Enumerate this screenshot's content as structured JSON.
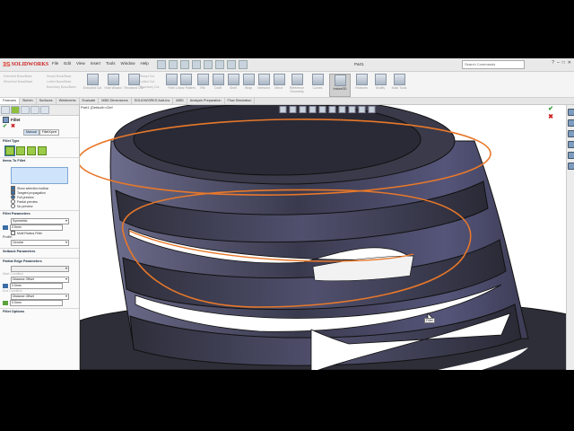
{
  "app": {
    "brand": "SOLIDWORKS",
    "menus": [
      "File",
      "Edit",
      "View",
      "Insert",
      "Tools",
      "Window",
      "Help"
    ],
    "doc_title": "Part1",
    "search_placeholder": "Search Commands"
  },
  "command_manager": {
    "small_col1": [
      "Extruded Boss/Base",
      "Revolved Boss/Base"
    ],
    "small_col2": [
      "Swept Boss/Base",
      "Lofted Boss/Base",
      "Boundary Boss/Base"
    ],
    "small_col3": [
      "Swept Cut",
      "Lofted Cut",
      "Boundary Cut"
    ],
    "buttons": [
      {
        "label": "Extruded Cut"
      },
      {
        "label": "Hole Wizard"
      },
      {
        "label": "Revolved Cut"
      },
      {
        "label": "Fillet"
      },
      {
        "label": "Linear Pattern"
      },
      {
        "label": "Rib"
      },
      {
        "label": "Draft"
      },
      {
        "label": "Shell"
      },
      {
        "label": "Wrap"
      },
      {
        "label": "Intersect"
      },
      {
        "label": "Mirror"
      },
      {
        "label": "Reference Geometry"
      },
      {
        "label": "Curves"
      },
      {
        "label": "Instant3D"
      },
      {
        "label": "Features"
      },
      {
        "label": "Modify"
      },
      {
        "label": "Mold Tools"
      }
    ],
    "active_label": "Instant3D"
  },
  "tabs": [
    "Features",
    "Sketch",
    "Surfaces",
    "Weldments",
    "Evaluate",
    "MBD Dimensions",
    "SOLIDWORKS Add-Ins",
    "MBD",
    "Analysis Preparation",
    "Flow Simulation"
  ],
  "active_tab": "Features",
  "panel": {
    "feature_title": "Fillet",
    "modes": [
      "Manual",
      "FilletXpert"
    ],
    "sections": {
      "fillet_type": "Fillet Type",
      "items_to_fillet": "Items To Fillet",
      "fillet_parameters": "Fillet Parameters",
      "profile": "Profile:",
      "setback": "Setback Parameters",
      "partial_edge": "Partial Edge Parameters",
      "fillet_options": "Fillet Options"
    },
    "options": [
      {
        "label": "Show selection toolbar",
        "kind": "checkbox",
        "checked": true
      },
      {
        "label": "Tangent propagation",
        "kind": "checkbox",
        "checked": true
      },
      {
        "label": "Full preview",
        "kind": "radio",
        "checked": true
      },
      {
        "label": "Partial preview",
        "kind": "radio",
        "checked": false
      },
      {
        "label": "No preview",
        "kind": "radio",
        "checked": false
      }
    ],
    "parameter_type": "Symmetric",
    "radius_value": "0.5mm",
    "multi_radius_label": "Multi Radius Fillet",
    "profile_value": "Circular",
    "start_condition_label": "Start Condition",
    "start_condition_value": "Distance Offset",
    "start_value": "0.0mm",
    "end_condition_label": "End Condition",
    "end_condition_value": "Distance Offset",
    "end_value": "0.0mm"
  },
  "viewport": {
    "tree_label": "Part1 (Default<<Def",
    "tooltip": "Fillet"
  },
  "colors": {
    "edge_highlight": "#e8782a",
    "body_dark": "#2a2a36",
    "body_face": "#56567a",
    "selection_blue": "#cfe4fb",
    "accept_green": "#2e9a2e",
    "cancel_red": "#cc2222"
  }
}
